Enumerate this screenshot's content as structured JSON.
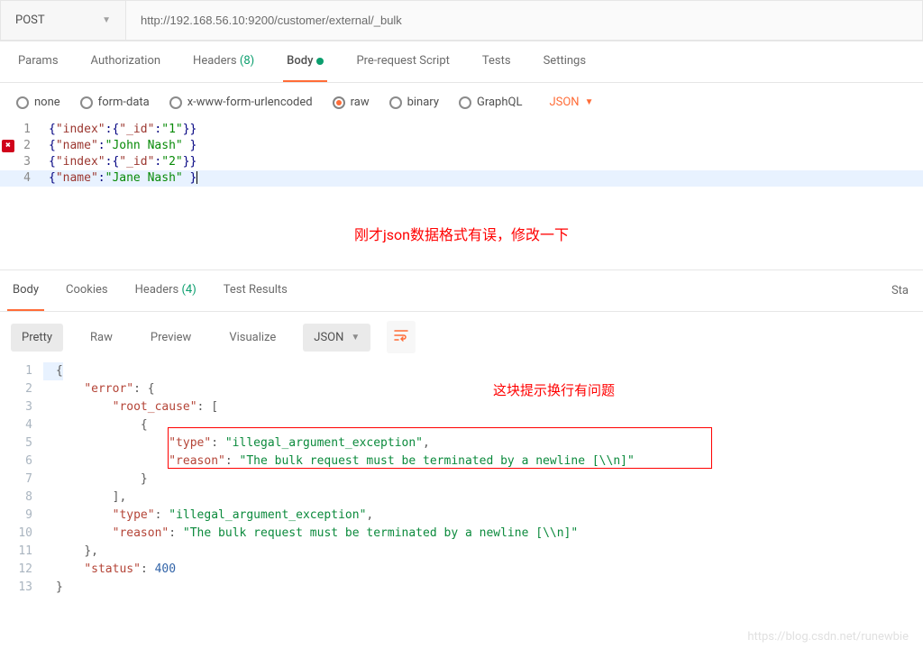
{
  "request": {
    "method": "POST",
    "url": "http://192.168.56.10:9200/customer/external/_bulk"
  },
  "tabs": {
    "items": [
      {
        "label": "Params"
      },
      {
        "label": "Authorization"
      },
      {
        "label": "Headers",
        "badge": "(8)"
      },
      {
        "label": "Body",
        "hasDot": true
      },
      {
        "label": "Pre-request Script"
      },
      {
        "label": "Tests"
      },
      {
        "label": "Settings"
      }
    ],
    "active": "Body"
  },
  "bodyOptions": [
    "none",
    "form-data",
    "x-www-form-urlencoded",
    "raw",
    "binary",
    "GraphQL"
  ],
  "bodySelected": "raw",
  "contentType": "JSON",
  "editor": {
    "lines": [
      {
        "n": "1",
        "tokens": [
          {
            "t": "{",
            "c": "brace"
          },
          {
            "t": "\"index\"",
            "c": "key"
          },
          {
            "t": ":",
            "c": "punct"
          },
          {
            "t": "{",
            "c": "brace"
          },
          {
            "t": "\"_id\"",
            "c": "key"
          },
          {
            "t": ":",
            "c": "punct"
          },
          {
            "t": "\"1\"",
            "c": "str"
          },
          {
            "t": "}}",
            "c": "brace"
          }
        ]
      },
      {
        "n": "2",
        "error": true,
        "tokens": [
          {
            "t": "{",
            "c": "brace"
          },
          {
            "t": "\"name\"",
            "c": "key"
          },
          {
            "t": ":",
            "c": "punct"
          },
          {
            "t": "\"John Nash\"",
            "c": "str"
          },
          {
            "t": " }",
            "c": "brace"
          }
        ]
      },
      {
        "n": "3",
        "tokens": [
          {
            "t": "{",
            "c": "brace"
          },
          {
            "t": "\"index\"",
            "c": "key"
          },
          {
            "t": ":",
            "c": "punct"
          },
          {
            "t": "{",
            "c": "brace"
          },
          {
            "t": "\"_id\"",
            "c": "key"
          },
          {
            "t": ":",
            "c": "punct"
          },
          {
            "t": "\"2\"",
            "c": "str"
          },
          {
            "t": "}}",
            "c": "brace"
          }
        ]
      },
      {
        "n": "4",
        "highlight": true,
        "cursor": true,
        "tokens": [
          {
            "t": "{",
            "c": "brace"
          },
          {
            "t": "\"name\"",
            "c": "key"
          },
          {
            "t": ":",
            "c": "punct"
          },
          {
            "t": "\"Jane Nash\"",
            "c": "str"
          },
          {
            "t": " }",
            "c": "brace"
          }
        ]
      }
    ]
  },
  "annotation1": "刚才json数据格式有误，修改一下",
  "responseTabs": {
    "items": [
      {
        "label": "Body"
      },
      {
        "label": "Cookies"
      },
      {
        "label": "Headers",
        "badge": "(4)"
      },
      {
        "label": "Test Results"
      }
    ],
    "active": "Body",
    "rightLabel": "Sta"
  },
  "responseToolbar": {
    "views": [
      "Pretty",
      "Raw",
      "Preview",
      "Visualize"
    ],
    "active": "Pretty",
    "format": "JSON"
  },
  "response": {
    "lines": [
      {
        "n": "1",
        "indent": 0,
        "render": "obj-open"
      },
      {
        "n": "2",
        "indent": 1,
        "key": "error",
        "render": "key-obj-open"
      },
      {
        "n": "3",
        "indent": 2,
        "key": "root_cause",
        "render": "key-arr-open"
      },
      {
        "n": "4",
        "indent": 3,
        "render": "obj-open-plain"
      },
      {
        "n": "5",
        "indent": 4,
        "key": "type",
        "val": "illegal_argument_exception",
        "comma": true,
        "render": "kv"
      },
      {
        "n": "6",
        "indent": 4,
        "key": "reason",
        "val": "The bulk request must be terminated by a newline [\\\\n]",
        "render": "kv"
      },
      {
        "n": "7",
        "indent": 3,
        "render": "obj-close"
      },
      {
        "n": "8",
        "indent": 2,
        "comma": true,
        "render": "arr-close"
      },
      {
        "n": "9",
        "indent": 2,
        "key": "type",
        "val": "illegal_argument_exception",
        "comma": true,
        "render": "kv"
      },
      {
        "n": "10",
        "indent": 2,
        "key": "reason",
        "val": "The bulk request must be terminated by a newline [\\\\n]",
        "render": "kv"
      },
      {
        "n": "11",
        "indent": 1,
        "comma": true,
        "render": "obj-close"
      },
      {
        "n": "12",
        "indent": 1,
        "key": "status",
        "num": 400,
        "render": "kv-num"
      },
      {
        "n": "13",
        "indent": 0,
        "render": "obj-close"
      }
    ]
  },
  "annotation2": "这块提示换行有问题",
  "watermark": "https://blog.csdn.net/runewbie",
  "errorGlyph": "✖"
}
